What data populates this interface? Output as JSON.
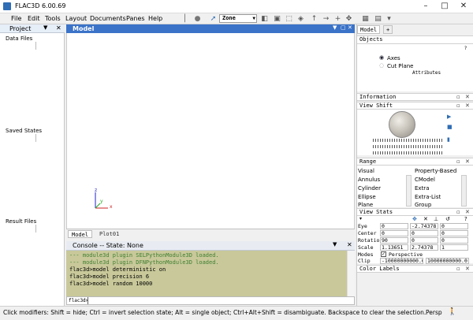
{
  "window": {
    "title": "FLAC3D 6.00.69",
    "minimize": "–",
    "maximize": "□",
    "close": "✕"
  },
  "menu": [
    {
      "label": "File"
    },
    {
      "label": "Edit"
    },
    {
      "label": "Tools"
    },
    {
      "label": "Layout"
    },
    {
      "label": "Documents"
    },
    {
      "label": "Panes"
    },
    {
      "label": "Help"
    }
  ],
  "toolbar": {
    "zone_select": "Zone"
  },
  "project": {
    "header": "Project",
    "sections": [
      "Data Files",
      "Saved States",
      "Result Files"
    ]
  },
  "model_view": {
    "title": "Model",
    "axes": {
      "x": "x",
      "y": "y",
      "z": "z"
    },
    "tabs": [
      "Model",
      "Plot01"
    ]
  },
  "console": {
    "title": "Console -- State: None",
    "lines": [
      {
        "text": "--- module3d plugin SELPythonModule3D loaded.",
        "color": "#3f7f2f"
      },
      {
        "text": "--- module3d plugin DFNPythonModule3D loaded.",
        "color": "#3f7f2f"
      },
      {
        "text": "flac3d>model deterministic on",
        "color": "#000000"
      },
      {
        "text": "flac3d>model precision 6",
        "color": "#000000"
      },
      {
        "text": "flac3d>model random 10000",
        "color": "#000000"
      }
    ],
    "prompt": "flac3d>"
  },
  "status": {
    "text": "Click modifiers: Shift = hide; Ctrl = invert selection state; Alt = single object; Ctrl+Alt+Shift = disambiguate.  Backspace to clear the selection.",
    "mode": "Persp"
  },
  "right_dock": {
    "tabs": [
      "Model",
      "+"
    ],
    "objects": {
      "title": "Objects",
      "items": [
        "Axes",
        "Cut Plane"
      ],
      "attributes": "Attributes",
      "help": "?"
    },
    "information": {
      "title": "Information"
    },
    "view_shift": {
      "title": "View Shift"
    },
    "range": {
      "title": "Range",
      "left": [
        "Visual",
        "Annulus",
        "Cylinder",
        "Ellipse",
        "Plane"
      ],
      "right": [
        "Property-Based",
        "CModel",
        "Extra",
        "Extra-List",
        "Group"
      ]
    },
    "view_stats": {
      "title": "View Stats",
      "rows": [
        {
          "label": "Eye",
          "v1": "0",
          "v2": "-2.74378",
          "v3": "0"
        },
        {
          "label": "Center",
          "v1": "0",
          "v2": "0",
          "v3": "0"
        },
        {
          "label": "Rotation",
          "v1": "90",
          "v2": "0",
          "v3": "0"
        },
        {
          "label": "Scale",
          "v1": "1.13651",
          "v2": "2.74378",
          "v3": "1"
        }
      ],
      "modes_label": "Modes",
      "perspective": "Perspective",
      "clip_label": "Clip",
      "clip_v1": "-10000000000.0",
      "clip_v2": "10000000000.0"
    },
    "color_labels": {
      "title": "Color Labels"
    }
  },
  "colors": {
    "accent": "#3b73c8",
    "console_bg": "#c8c89a",
    "console_green": "#3f7f2f"
  }
}
